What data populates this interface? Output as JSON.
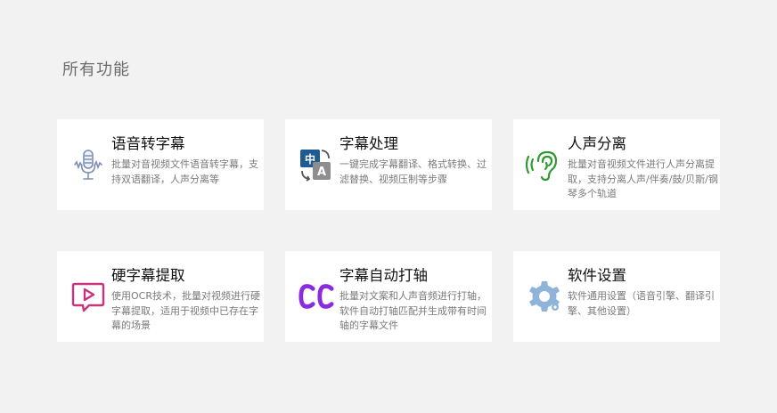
{
  "section_title": "所有功能",
  "cards": [
    {
      "title": "语音转字幕",
      "desc": "批量对音视频文件语音转字幕，支持双语翻译，人声分离等",
      "icon": "microphone-icon"
    },
    {
      "title": "字幕处理",
      "desc": "一键完成字幕翻译、格式转换、过滤替换、视频压制等步骤",
      "icon": "translate-icon"
    },
    {
      "title": "人声分离",
      "desc": "批量对音视频文件进行人声分离提取，支持分离人声/伴奏/鼓/贝斯/钢琴多个轨道",
      "icon": "ear-icon"
    },
    {
      "title": "硬字幕提取",
      "desc": "使用OCR技术，批量对视频进行硬字幕提取，适用于视频中已存在字幕的场景",
      "icon": "video-play-icon"
    },
    {
      "title": "字幕自动打轴",
      "desc": "批量对文案和人声音频进行打轴，软件自动打轴匹配并生成带有时间轴的字幕文件",
      "icon": "cc-icon"
    },
    {
      "title": "软件设置",
      "desc": "软件通用设置（语音引擎、翻译引擎、其他设置）",
      "icon": "gear-icon"
    }
  ],
  "colors": {
    "background": "#f2f2f2",
    "card": "#ffffff",
    "translate_blue": "#1f5a93",
    "ear_green": "#2e9a2e",
    "video_pink": "#c8327e",
    "cc_purple": "#8a2be2",
    "gear_blue": "#8fb3d9"
  }
}
